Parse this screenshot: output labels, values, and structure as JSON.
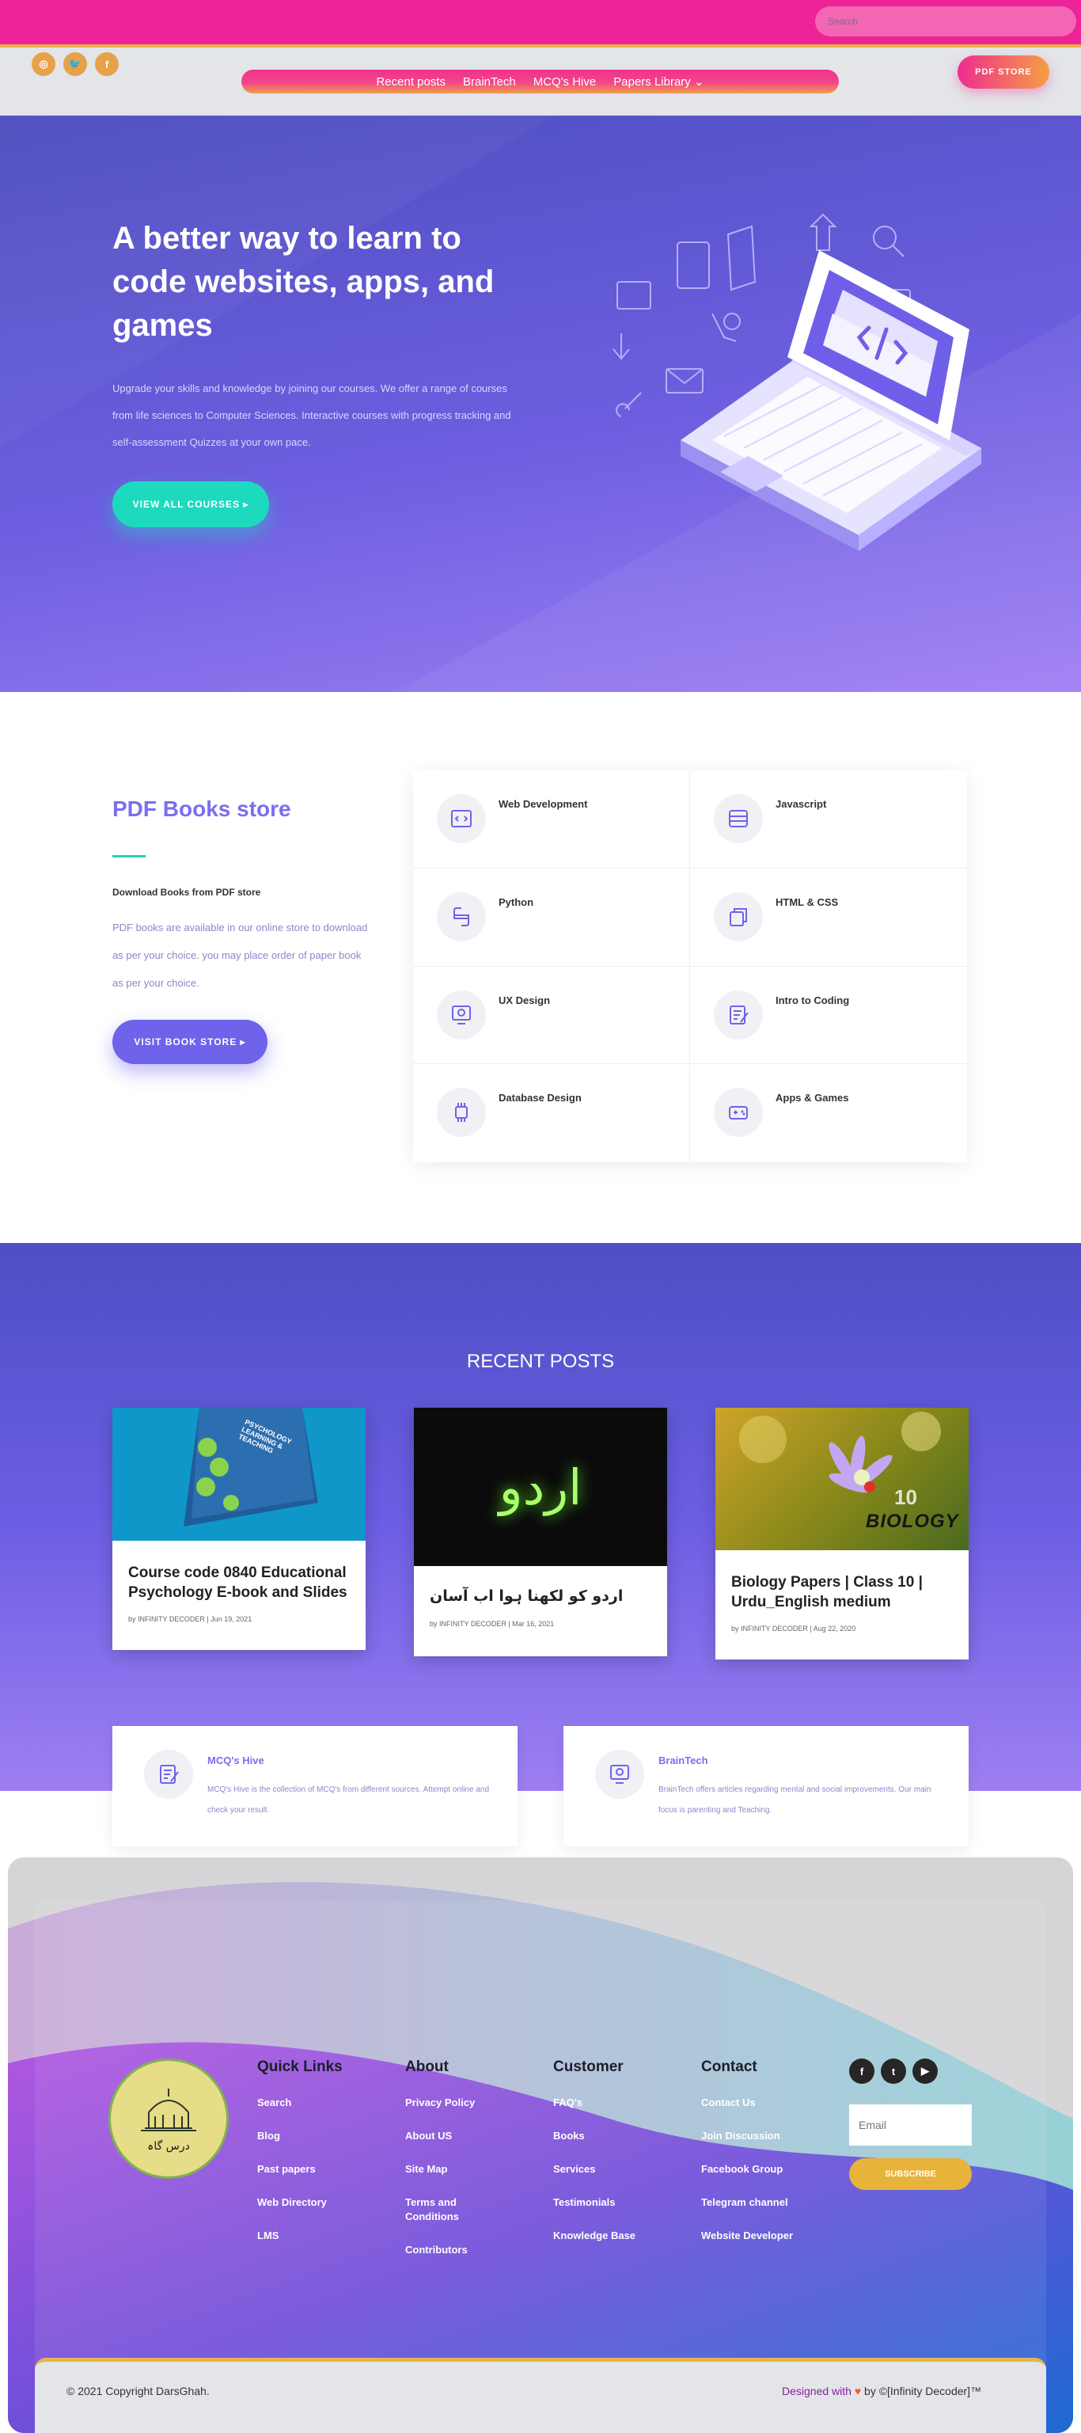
{
  "topbar": {
    "search_placeholder": "Search"
  },
  "header": {
    "social": [
      {
        "icon": "instagram-icon",
        "glyph": "◎"
      },
      {
        "icon": "twitter-icon",
        "glyph": "🐦"
      },
      {
        "icon": "facebook-icon",
        "glyph": "f"
      }
    ],
    "nav": [
      "Recent posts",
      "BrainTech",
      "MCQ's Hive",
      "Papers Library ⌄"
    ],
    "pdf_store": "PDF STORE"
  },
  "hero": {
    "title": "A better way to learn to code websites, apps, and games",
    "description": "Upgrade your skills and knowledge by joining our courses. We offer a range of courses from life sciences to Computer Sciences. Interactive courses with progress tracking and self-assessment Quizzes at your own pace.",
    "button": "VIEW ALL COURSES  ▸"
  },
  "books": {
    "title": "PDF Books store",
    "subtitle": "Download Books from PDF store",
    "description": "PDF books are available in our online store to download as per your choice. you may place order of paper book as per your choice.",
    "button": "VISIT BOOK STORE  ▸",
    "categories": [
      {
        "label": "Web Development",
        "icon": "code-window-icon"
      },
      {
        "label": "Javascript",
        "icon": "database-icon"
      },
      {
        "label": "Python",
        "icon": "python-icon"
      },
      {
        "label": "HTML & CSS",
        "icon": "files-icon"
      },
      {
        "label": "UX Design",
        "icon": "lightbulb-icon"
      },
      {
        "label": "Intro to Coding",
        "icon": "notepad-icon"
      },
      {
        "label": "Database Design",
        "icon": "chip-icon"
      },
      {
        "label": "Apps & Games",
        "icon": "gamepad-icon"
      }
    ]
  },
  "recent": {
    "title": "RECENT POSTS",
    "posts": [
      {
        "title": "Course code 0840 Educational Psychology E-book and Slides",
        "meta": "by INFINITY DECODER | Jun 19, 2021",
        "image_text": "PSYCHOLOGY LEARNING & TEACHING"
      },
      {
        "title": "اردو کو لکھنا ہوا اب آسان",
        "meta": "by INFINITY DECODER | Mar 16, 2021",
        "image_text": "اردو"
      },
      {
        "title": "Biology Papers | Class 10 | Urdu_English medium",
        "meta": "by INFINITY DECODER | Aug 22, 2020",
        "image_text": "BIOLOGY",
        "image_num": "10"
      }
    ]
  },
  "features": [
    {
      "title": "MCQ's Hive",
      "desc": "MCQ's Hive is the collection of MCQ's from different sources. Attempt online and check your result.",
      "icon": "notepad-icon"
    },
    {
      "title": "BrainTech",
      "desc": "BrainTech offers articles regarding mental and social improvements. Our main focus is parenting and Teaching.",
      "icon": "lightbulb-icon"
    }
  ],
  "footer": {
    "logo_text": "درس گاہ",
    "columns": [
      {
        "heading": "Quick Links",
        "items": [
          "Search",
          "Blog",
          "Past papers",
          "Web Directory",
          "LMS"
        ]
      },
      {
        "heading": "About",
        "items": [
          "Privacy Policy",
          "About US",
          "Site Map",
          "Terms and Conditions",
          "Contributors"
        ]
      },
      {
        "heading": "Customer",
        "items": [
          "FAQ's",
          "Books",
          "Services",
          "Testimonials",
          "Knowledge Base"
        ]
      },
      {
        "heading": "Contact",
        "items": [
          "Contact Us",
          "Join Discussion",
          "Facebook Group",
          "Telegram channel",
          "Website Developer"
        ]
      }
    ],
    "social": [
      {
        "icon": "facebook-icon",
        "glyph": "f"
      },
      {
        "icon": "twitter-icon",
        "glyph": "t"
      },
      {
        "icon": "youtube-icon",
        "glyph": "▶"
      }
    ],
    "email_placeholder": "Email",
    "subscribe": "SUBSCRIBE",
    "copyright": "© 2021 Copyright DarsGhah.",
    "designed_prefix": "Designed with",
    "designed_suffix": "by ©[Infinity Decoder]™"
  },
  "colors": {
    "topbar": "#ee2397",
    "accent_gold": "#e9b24a",
    "purple": "#6e63ea",
    "teal": "#1ddabf"
  }
}
